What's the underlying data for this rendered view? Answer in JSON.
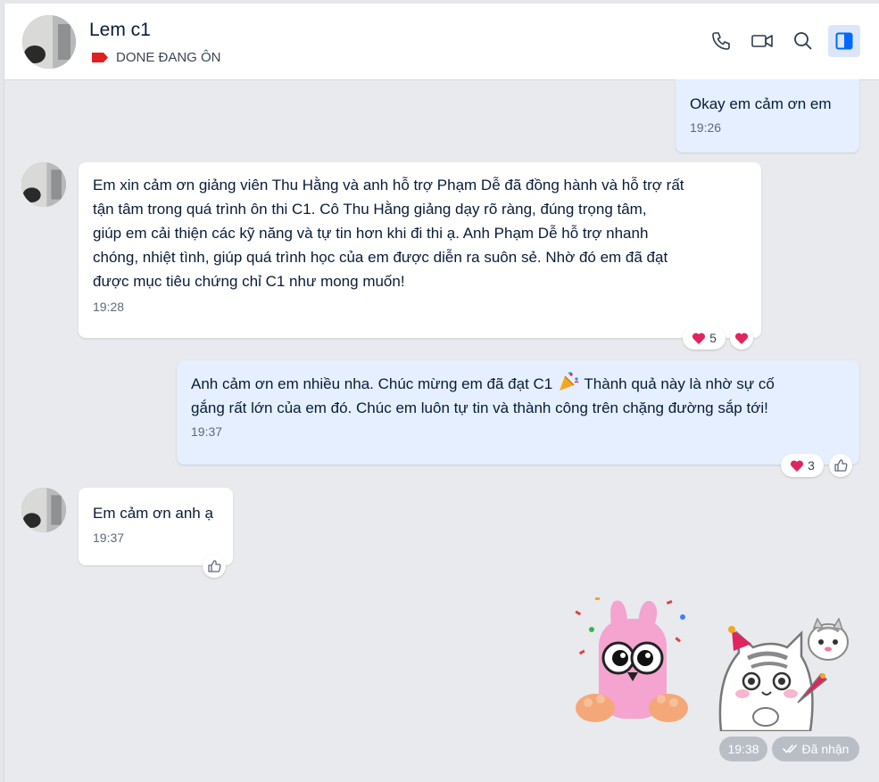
{
  "header": {
    "contact_name": "Lem c1",
    "tag_label": "DONE ĐANG ÔN",
    "tag_color": "#e02020",
    "icons": [
      "phone-icon",
      "video-call-icon",
      "search-icon",
      "sidebar-toggle-icon"
    ]
  },
  "messages": [
    {
      "direction": "out",
      "text": "Okay em cảm ơn em",
      "time": "19:26"
    },
    {
      "direction": "in",
      "text": "Em xin cảm ơn giảng viên Thu Hằng và anh hỗ trợ Phạm Dễ đã đồng hành và hỗ trợ rất\ntận tâm trong quá trình ôn thi C1. Cô Thu Hằng giảng dạy rõ ràng, đúng trọng tâm,\ngiúp em cải thiện các kỹ năng và tự tin hơn khi đi thi ạ. Anh Phạm Dễ hỗ trợ nhanh\nchóng, nhiệt tình, giúp quá trình học của em được diễn ra suôn sẻ. Nhờ đó em đã đạt\nđược mục tiêu chứng chỉ C1 như mong muốn!",
      "time": "19:28",
      "reaction_count": "5"
    },
    {
      "direction": "out",
      "text_a": "Anh cảm ơn em nhiều nha. Chúc mừng em đã đạt C1",
      "text_b": "Thành quả này là nhờ sự cố\ngắng rất lớn của em đó. Chúc em luôn tự tin và thành công trên chặng đường sắp tới!",
      "time": "19:37",
      "reaction_count": "3"
    },
    {
      "direction": "in",
      "text": "Em cảm ơn anh ạ",
      "time": "19:37"
    }
  ],
  "sticker_status": {
    "time": "19:38",
    "received_label": "Đã nhận"
  },
  "colors": {
    "background": "#e8eaed",
    "bubble_in": "#ffffff",
    "bubble_out": "#e5efff",
    "accent": "#0068ff",
    "heart": "#e0245e"
  }
}
